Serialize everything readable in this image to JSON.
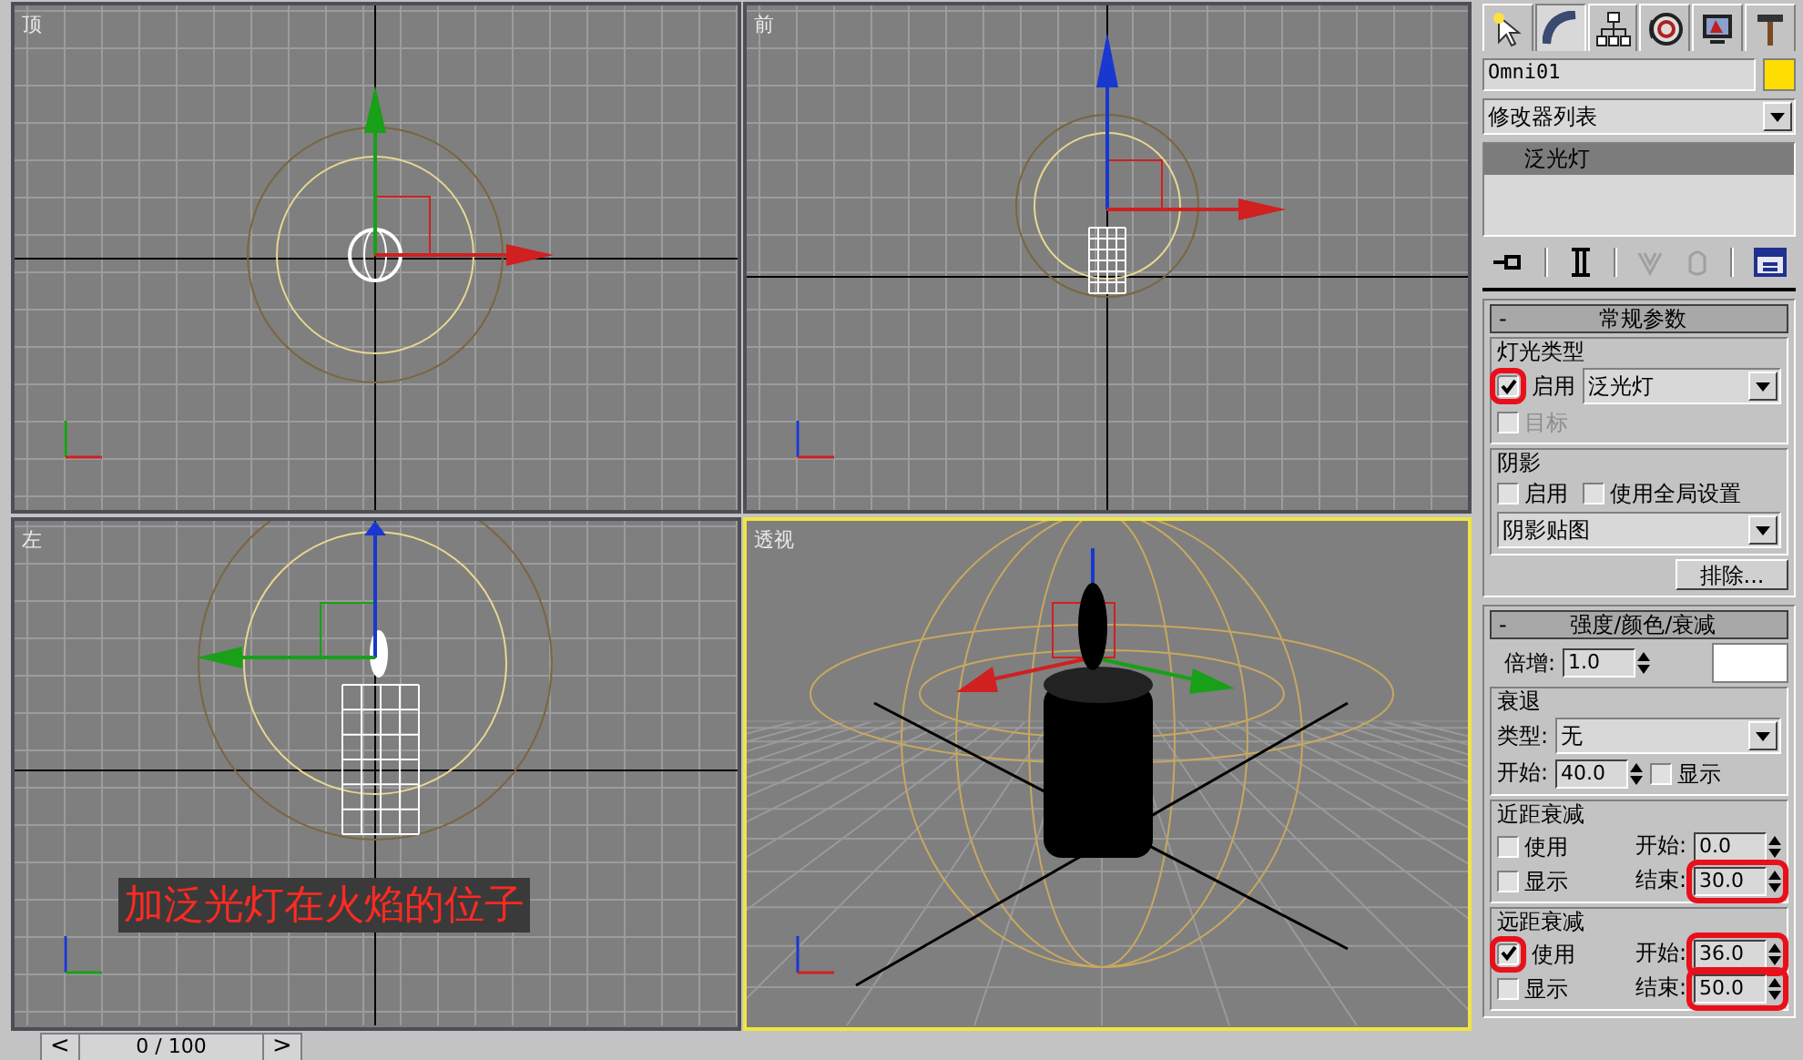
{
  "viewports": [
    {
      "kind": "top",
      "label": "顶",
      "selected": false
    },
    {
      "kind": "front",
      "label": "前",
      "selected": false
    },
    {
      "kind": "left",
      "label": "左",
      "selected": false,
      "caption": "加泛光灯在火焰的位子"
    },
    {
      "kind": "perspective",
      "label": "透视",
      "selected": true
    }
  ],
  "timeline": {
    "prev": "<",
    "position": "0 / 100",
    "next": ">",
    "level": 0
  },
  "panel": {
    "tabs": [
      {
        "kind": "create",
        "selected": false
      },
      {
        "kind": "modify",
        "selected": true
      },
      {
        "kind": "hierarchy",
        "selected": false
      },
      {
        "kind": "motion",
        "selected": false
      },
      {
        "kind": "display",
        "selected": false
      },
      {
        "kind": "utilities",
        "selected": false
      }
    ],
    "object": {
      "name": "Omni01",
      "color": "#ffdd00"
    },
    "modifier_list": "修改器列表",
    "stack": [
      {
        "label": "泛光灯",
        "selected": true
      }
    ],
    "stack_tools": [
      {
        "kind": "pin",
        "disabled": false
      },
      {
        "kind": "end-result",
        "disabled": false
      },
      {
        "kind": "make-unique",
        "disabled": true
      },
      {
        "kind": "remove",
        "disabled": true
      },
      {
        "kind": "configure",
        "disabled": false
      }
    ],
    "general": {
      "collapse": "-",
      "title": "常规参数",
      "light_type": {
        "title": "灯光类型",
        "enable": {
          "label": "启用",
          "checked": true,
          "highlighted": true
        },
        "type": "泛光灯",
        "target": {
          "label": "目标",
          "checked": false,
          "disabled": true
        }
      },
      "shadows": {
        "title": "阴影",
        "enable": {
          "label": "启用",
          "checked": false
        },
        "global": {
          "label": "使用全局设置",
          "checked": false
        },
        "type": "阴影贴图"
      },
      "exclude": "排除..."
    },
    "intensity": {
      "collapse": "-",
      "title": "强度/颜色/衰减",
      "multiplier": {
        "label": "倍增:",
        "value": "1.0"
      },
      "decay": {
        "title": "衰退",
        "type_label": "类型:",
        "type": "无",
        "start_label": "开始:",
        "start": "40.0",
        "show": {
          "label": "显示",
          "checked": false
        }
      },
      "near": {
        "title": "近距衰减",
        "use": {
          "label": "使用",
          "checked": false
        },
        "show": {
          "label": "显示",
          "checked": false
        },
        "start_label": "开始:",
        "start": "0.0",
        "end_label": "结束:",
        "end": "30.0",
        "end_highlighted": true
      },
      "far": {
        "title": "远距衰减",
        "use": {
          "label": "使用",
          "checked": true,
          "highlighted": true
        },
        "show": {
          "label": "显示",
          "checked": false
        },
        "start_label": "开始:",
        "start": "36.0",
        "end_label": "结束:",
        "end": "50.0",
        "values_highlighted": true
      }
    }
  }
}
